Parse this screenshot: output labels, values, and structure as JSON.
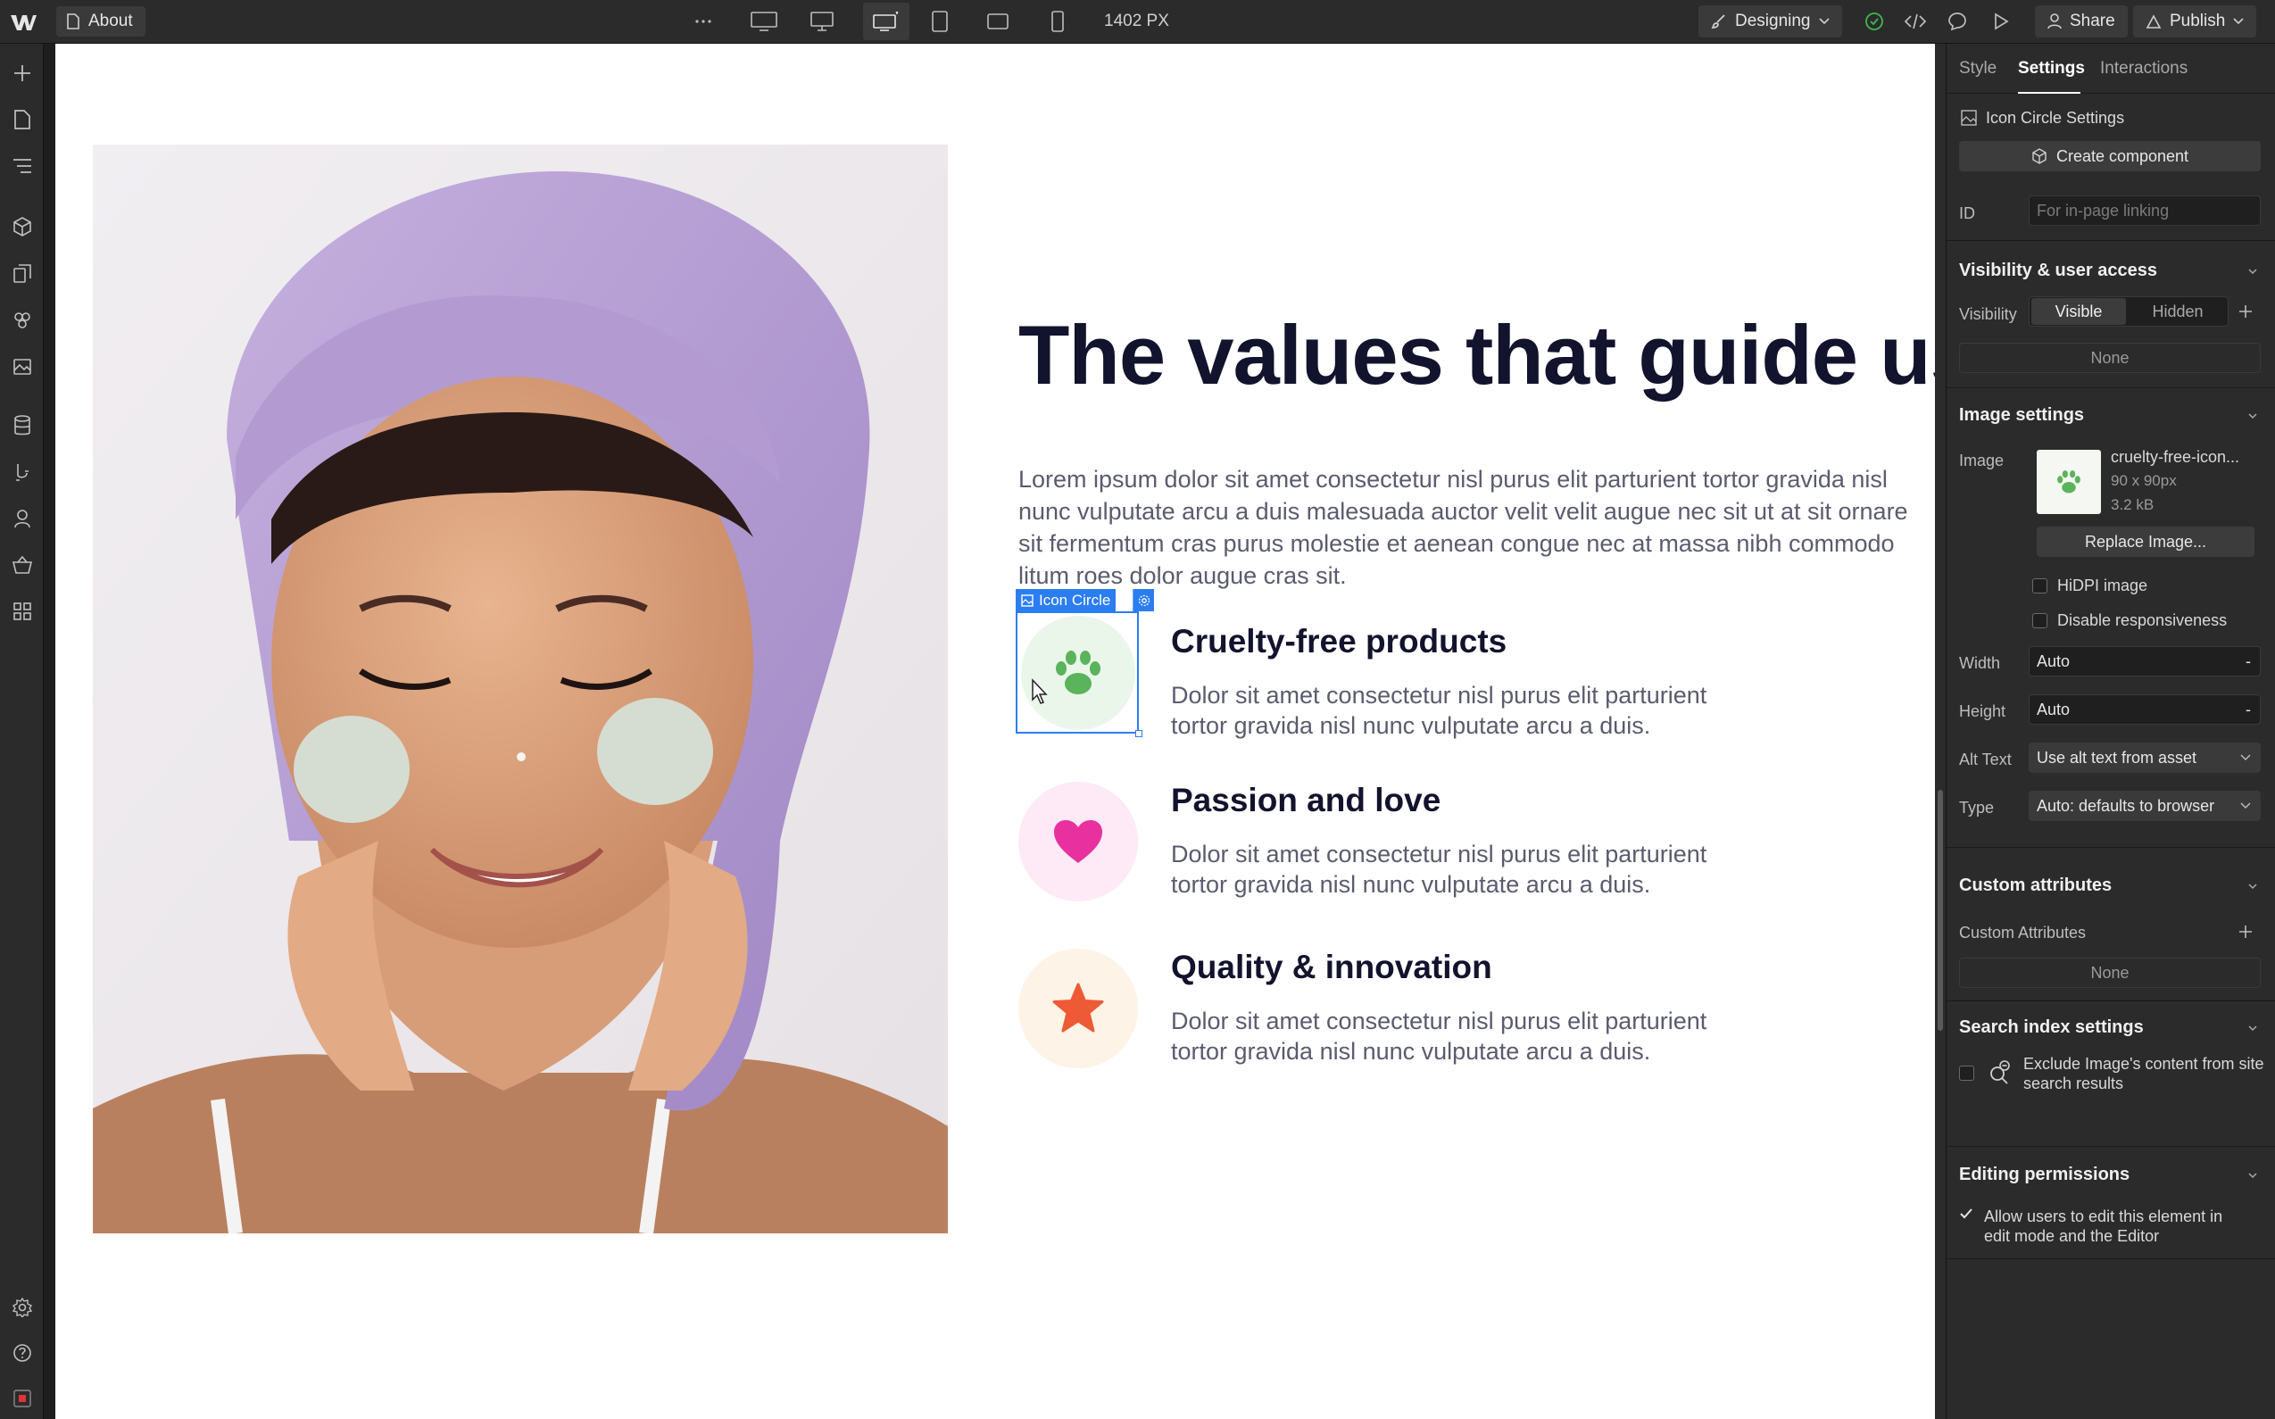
{
  "topbar": {
    "page_name": "About",
    "width_readout": "1402 PX",
    "mode_label": "Designing",
    "share_label": "Share",
    "publish_label": "Publish"
  },
  "canvas": {
    "heading": "The values that guide us",
    "intro": "Lorem ipsum dolor sit amet consectetur nisl purus elit parturient tortor gravida nisl nunc vulputate arcu a duis malesuada auctor velit velit augue nec sit ut at sit ornare sit fermentum cras purus molestie et aenean congue nec at massa nibh commodo litum roes dolor augue cras sit.",
    "selection_label": "Icon Circle",
    "values": [
      {
        "title": "Cruelty-free products",
        "desc": "Dolor sit amet consectetur nisl purus elit parturient tortor gravida nisl nunc vulputate arcu a duis.",
        "icon": "paw-icon",
        "circle_color": "#eaf6ea",
        "icon_color": "#5bb35b"
      },
      {
        "title": "Passion and love",
        "desc": "Dolor sit amet consectetur nisl purus elit parturient tortor gravida nisl nunc vulputate arcu a duis.",
        "icon": "heart-icon",
        "circle_color": "#fdeaf6",
        "icon_color": "#e8319f"
      },
      {
        "title": "Quality & innovation",
        "desc": "Dolor sit amet consectetur nisl purus elit parturient tortor gravida nisl nunc vulputate arcu a duis.",
        "icon": "star-icon",
        "circle_color": "#fdf3e6",
        "icon_color": "#ee5a36"
      }
    ]
  },
  "panel": {
    "tabs": [
      "Style",
      "Settings",
      "Interactions"
    ],
    "active_tab": "Settings",
    "settings_title": "Icon Circle Settings",
    "create_component": "Create component",
    "id_label": "ID",
    "id_placeholder": "For in-page linking",
    "visibility_section": "Visibility & user access",
    "visibility_label": "Visibility",
    "visible_option": "Visible",
    "hidden_option": "Hidden",
    "visibility_none": "None",
    "image_section": "Image settings",
    "image_label": "Image",
    "image_name": "cruelty-free-icon...",
    "image_dims": "90 x 90px",
    "image_size": "3.2 kB",
    "replace_image": "Replace Image...",
    "hidpi_label": "HiDPI image",
    "disable_resp_label": "Disable responsiveness",
    "width_label": "Width",
    "width_value": "Auto",
    "height_label": "Height",
    "height_value": "Auto",
    "alt_label": "Alt Text",
    "alt_value": "Use alt text from asset",
    "type_label": "Type",
    "type_value": "Auto: defaults to browser",
    "dash": "-",
    "custom_attr_section": "Custom attributes",
    "custom_attr_label": "Custom Attributes",
    "custom_attr_none": "None",
    "search_section": "Search index settings",
    "search_exclude": "Exclude Image's content from site search results",
    "edit_section": "Editing permissions",
    "edit_allow": "Allow users to edit this element in edit mode and the Editor"
  },
  "colors": {
    "selection": "#2b7df2",
    "heading": "#12132d",
    "body_text": "#5a5b6e"
  }
}
